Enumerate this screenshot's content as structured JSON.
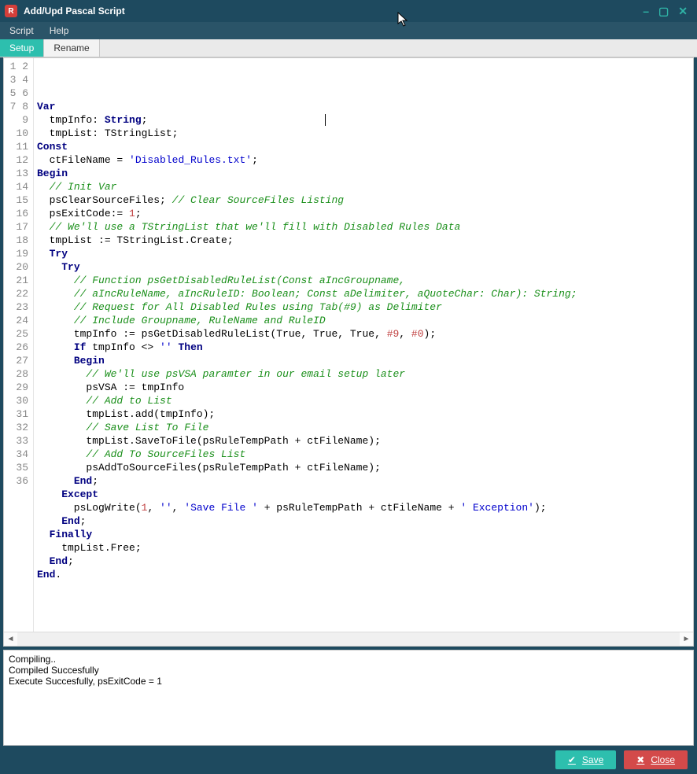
{
  "window": {
    "title": "Add/Upd Pascal Script",
    "app_icon_label": "R"
  },
  "menu": {
    "items": [
      "Script",
      "Help"
    ]
  },
  "tabs": {
    "items": [
      "Setup",
      "Rename"
    ],
    "active_index": 0
  },
  "editor": {
    "lines": [
      [
        [
          "Var",
          "kw"
        ]
      ],
      [
        [
          "  tmpInfo: ",
          ""
        ],
        [
          "String",
          "kw"
        ],
        [
          ";",
          ""
        ]
      ],
      [
        [
          "  tmpList: TStringList;",
          ""
        ]
      ],
      [
        [
          "Const",
          "kw"
        ]
      ],
      [
        [
          "  ctFileName = ",
          ""
        ],
        [
          "'Disabled_Rules.txt'",
          "st"
        ],
        [
          ";",
          ""
        ]
      ],
      [
        [
          "Begin",
          "kw"
        ]
      ],
      [
        [
          "  ",
          ""
        ],
        [
          "// Init Var",
          "cm"
        ]
      ],
      [
        [
          "  psClearSourceFiles; ",
          ""
        ],
        [
          "// Clear SourceFiles Listing",
          "cm"
        ]
      ],
      [
        [
          "  psExitCode:= ",
          ""
        ],
        [
          "1",
          "nu"
        ],
        [
          ";",
          ""
        ]
      ],
      [
        [
          "  ",
          ""
        ],
        [
          "// We'll use a TStringList that we'll fill with Disabled Rules Data",
          "cm"
        ]
      ],
      [
        [
          "  tmpList := TStringList.Create;",
          ""
        ]
      ],
      [
        [
          "  ",
          ""
        ],
        [
          "Try",
          "kw"
        ]
      ],
      [
        [
          "    ",
          ""
        ],
        [
          "Try",
          "kw"
        ]
      ],
      [
        [
          "      ",
          ""
        ],
        [
          "// Function psGetDisabledRuleList(Const aIncGroupname,",
          "cm"
        ]
      ],
      [
        [
          "      ",
          ""
        ],
        [
          "// aIncRuleName, aIncRuleID: Boolean; Const aDelimiter, aQuoteChar: Char): String;",
          "cm"
        ]
      ],
      [
        [
          "      ",
          ""
        ],
        [
          "// Request for All Disabled Rules using Tab(#9) as Delimiter",
          "cm"
        ]
      ],
      [
        [
          "      ",
          ""
        ],
        [
          "// Include Groupname, RuleName and RuleID",
          "cm"
        ]
      ],
      [
        [
          "      tmpInfo := psGetDisabledRuleList(True, True, True, ",
          ""
        ],
        [
          "#9",
          "nu"
        ],
        [
          ", ",
          ""
        ],
        [
          "#0",
          "nu"
        ],
        [
          ");",
          ""
        ]
      ],
      [
        [
          "      ",
          ""
        ],
        [
          "If",
          "kw"
        ],
        [
          " tmpInfo <> ",
          ""
        ],
        [
          "''",
          "st"
        ],
        [
          " ",
          ""
        ],
        [
          "Then",
          "kw"
        ]
      ],
      [
        [
          "      ",
          ""
        ],
        [
          "Begin",
          "kw"
        ]
      ],
      [
        [
          "        ",
          ""
        ],
        [
          "// We'll use psVSA paramter in our email setup later",
          "cm"
        ]
      ],
      [
        [
          "        psVSA := tmpInfo",
          ""
        ]
      ],
      [
        [
          "        ",
          ""
        ],
        [
          "// Add to List",
          "cm"
        ]
      ],
      [
        [
          "        tmpList.add(tmpInfo);",
          ""
        ]
      ],
      [
        [
          "        ",
          ""
        ],
        [
          "// Save List To File",
          "cm"
        ]
      ],
      [
        [
          "        tmpList.SaveToFile(psRuleTempPath + ctFileName);",
          ""
        ]
      ],
      [
        [
          "        ",
          ""
        ],
        [
          "// Add To SourceFiles List",
          "cm"
        ]
      ],
      [
        [
          "        psAddToSourceFiles(psRuleTempPath + ctFileName);",
          ""
        ]
      ],
      [
        [
          "      ",
          ""
        ],
        [
          "End",
          "kw"
        ],
        [
          ";",
          ""
        ]
      ],
      [
        [
          "    ",
          ""
        ],
        [
          "Except",
          "kw"
        ]
      ],
      [
        [
          "      psLogWrite(",
          ""
        ],
        [
          "1",
          "nu"
        ],
        [
          ", ",
          ""
        ],
        [
          "''",
          "st"
        ],
        [
          ", ",
          ""
        ],
        [
          "'Save File '",
          "st"
        ],
        [
          " + psRuleTempPath + ctFileName + ",
          ""
        ],
        [
          "' Exception'",
          "st"
        ],
        [
          ");",
          ""
        ]
      ],
      [
        [
          "    ",
          ""
        ],
        [
          "End",
          "kw"
        ],
        [
          ";",
          ""
        ]
      ],
      [
        [
          "  ",
          ""
        ],
        [
          "Finally",
          "kw"
        ]
      ],
      [
        [
          "    tmpList.Free;",
          ""
        ]
      ],
      [
        [
          "  ",
          ""
        ],
        [
          "End",
          "kw"
        ],
        [
          ";",
          ""
        ]
      ],
      [
        [
          "End",
          "kw"
        ],
        [
          ".",
          ""
        ]
      ]
    ]
  },
  "output": {
    "lines": [
      "Compiling..",
      "Compiled Succesfully",
      "Execute Succesfully, psExitCode = 1"
    ]
  },
  "footer": {
    "save_label": "Save",
    "close_label": "Close"
  }
}
